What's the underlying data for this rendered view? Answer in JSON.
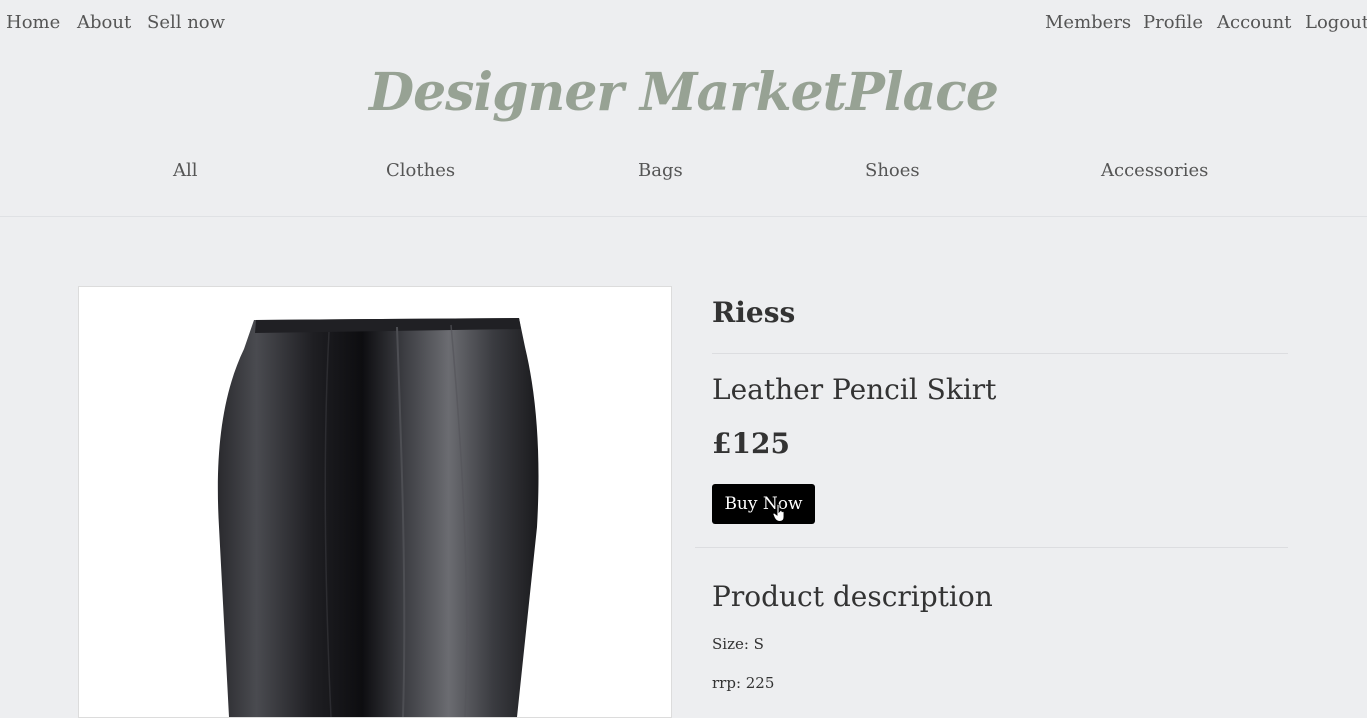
{
  "topnav": {
    "left": [
      "Home",
      "About",
      "Sell now"
    ],
    "right": [
      "Members",
      "Profile",
      "Account",
      "Logout"
    ]
  },
  "site_title": "Designer MarketPlace",
  "categories": [
    "All",
    "Clothes",
    "Bags",
    "Shoes",
    "Accessories"
  ],
  "product": {
    "brand": "Riess",
    "name": "Leather Pencil Skirt",
    "price": "£125",
    "buy_label": "Buy Now",
    "description_title": "Product description",
    "size": "Size: S",
    "rrp": "rrp: 225",
    "image_icon": "leather-skirt-photo"
  },
  "colors": {
    "background": "#edeef0",
    "brand_title": "#97a294",
    "button_bg": "#000000",
    "button_text": "#ffffff"
  }
}
